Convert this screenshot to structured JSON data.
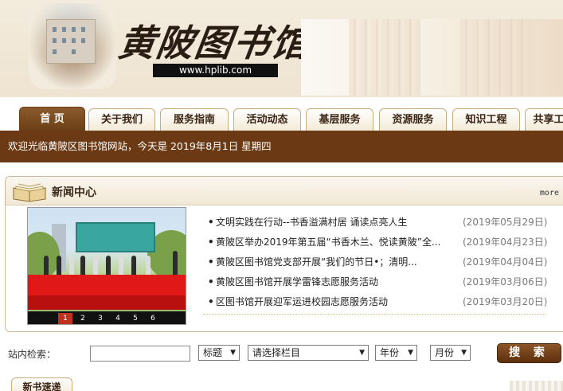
{
  "header": {
    "logo_text": "黄陂图书馆",
    "url": "www.hplib.com"
  },
  "nav": {
    "tabs": [
      {
        "label": "首 页",
        "active": true
      },
      {
        "label": "关于我们",
        "active": false
      },
      {
        "label": "服务指南",
        "active": false
      },
      {
        "label": "活动动态",
        "active": false
      },
      {
        "label": "基层服务",
        "active": false
      },
      {
        "label": "资源服务",
        "active": false
      },
      {
        "label": "知识工程",
        "active": false
      },
      {
        "label": "共享工",
        "active": false
      }
    ]
  },
  "welcome": {
    "text": "欢迎光临黄陂区图书馆网站，今天是 2019年8月1日 星期四"
  },
  "news": {
    "title": "新闻中心",
    "more": "more",
    "slides": [
      "1",
      "2",
      "3",
      "4",
      "5",
      "6"
    ],
    "items": [
      {
        "title": "文明实践在行动--书香溢满村居 诵读点亮人生",
        "date": "(2019年05月29日)"
      },
      {
        "title": "黄陂区举办2019年第五届“书香木兰、悦读黄陂”全...",
        "date": "(2019年04月23日)"
      },
      {
        "title": "黄陂区图书馆党支部开展“我们的节日•；清明...",
        "date": "(2019年04月04日)"
      },
      {
        "title": "黄陂区图书馆开展学雷锋志愿服务活动",
        "date": "(2019年03月06日)"
      },
      {
        "title": "区图书馆开展迎军运进校园志愿服务活动",
        "date": "(2019年03月20日)"
      }
    ]
  },
  "search": {
    "label": "站内检索：",
    "input_value": "",
    "field_select": "标题",
    "column_select": "请选择栏目",
    "year_select": "年份",
    "month_select": "月份",
    "button": "搜 索"
  },
  "bottom": {
    "new_books_tab": "新书速递"
  },
  "colors": {
    "accent_brown": "#6b3a14",
    "active_slide": "#c0311e"
  },
  "icons": {
    "news_header": "open-book-icon",
    "select_arrow": "triangle-down-icon"
  }
}
